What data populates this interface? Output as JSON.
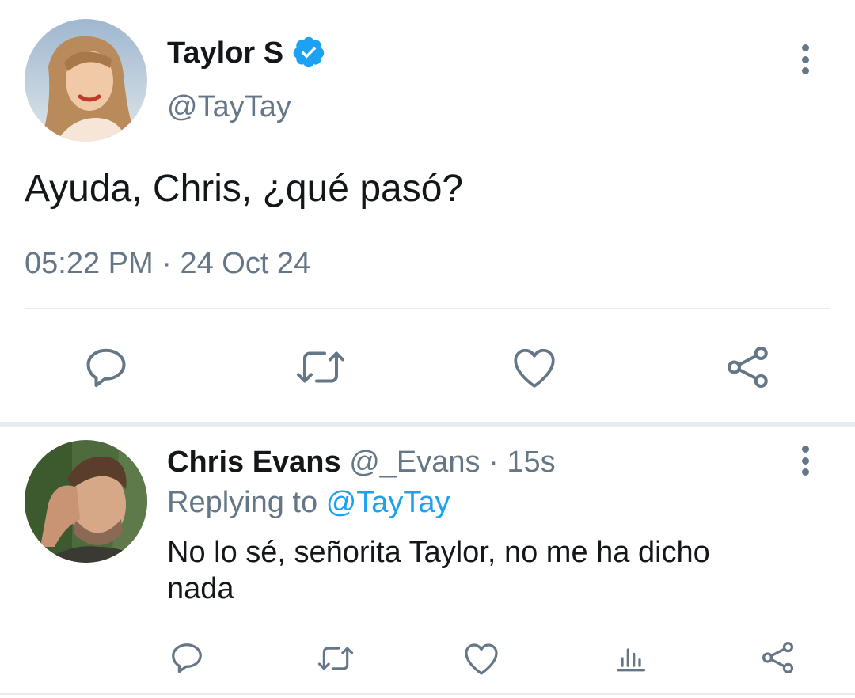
{
  "main_tweet": {
    "display_name": "Taylor S",
    "handle": "@TayTay",
    "text": "Ayuda, Chris, ¿qué pasó?",
    "time": "05:22 PM",
    "separator": "·",
    "date": "24 Oct 24",
    "verified": true
  },
  "reply": {
    "display_name": "Chris Evans",
    "handle": "@_Evans",
    "separator": "·",
    "age": "15s",
    "replying_label": "Replying to",
    "replying_handle": "@TayTay",
    "text": "No lo sé, señorita Taylor, no me ha dicho nada"
  },
  "icons": {
    "reply": "speech-bubble-icon",
    "retweet": "retweet-icon",
    "like": "heart-icon",
    "share": "share-icon",
    "analytics": "bar-chart-icon",
    "more": "vertical-dots-icon",
    "verified": "verified-badge-icon"
  },
  "colors": {
    "text": "#14171a",
    "muted": "#657786",
    "accent": "#1da1f2",
    "divider": "#e6ecf0"
  }
}
